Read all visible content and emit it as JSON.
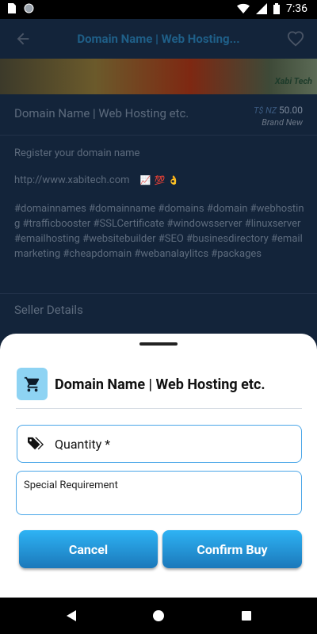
{
  "status_bar": {
    "time": "7:36"
  },
  "app_bar": {
    "title": "Domain Name | Web Hosting..."
  },
  "banner": {
    "logo_text": "Xabi Tech"
  },
  "listing": {
    "title": "Domain Name | Web Hosting etc.",
    "currency": "T$ NZ",
    "price": "50.00",
    "condition": "Brand New",
    "description_line1": "Register your domain name",
    "website": "http://www.xabitech.com",
    "hashtags": "#domainnames #domainname #domains #domain #webhosting #trafficbooster #SSLCertificate #windowsserver #linuxserver #emailhosting #websitebuilder #SEO #businesdirectory #emailmarketing #cheapdomain #webanalaylitcs #packages",
    "seller_section": "Seller Details"
  },
  "sheet": {
    "title": "Domain Name | Web Hosting etc.",
    "quantity_label": "Quantity *",
    "special_requirement_label": "Special Requirement",
    "cancel_label": "Cancel",
    "confirm_label": "Confirm Buy"
  },
  "colors": {
    "accent": "#2eb3f4",
    "accent_dark": "#1b78ba",
    "cart_bg": "#8ed3f3",
    "field_border": "#4aa6e8"
  }
}
